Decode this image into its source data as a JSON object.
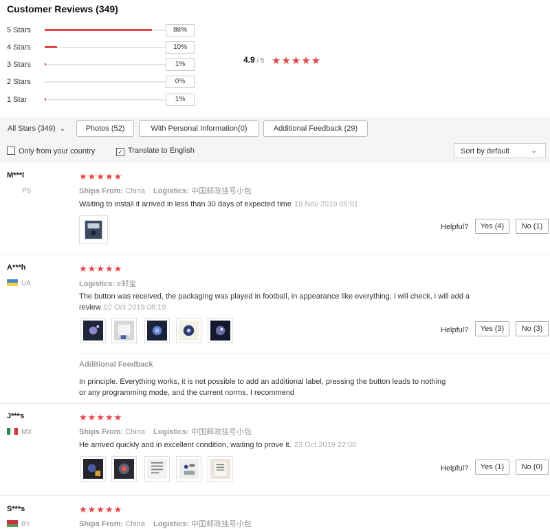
{
  "header": {
    "title": "Customer Reviews (349)"
  },
  "distribution": [
    {
      "label": "5 Stars",
      "pct_text": "88%",
      "fraction": 0.88
    },
    {
      "label": "4 Stars",
      "pct_text": "10%",
      "fraction": 0.1
    },
    {
      "label": "3 Stars",
      "pct_text": "1%",
      "fraction": 0.01
    },
    {
      "label": "2 Stars",
      "pct_text": "0%",
      "fraction": 0.0
    },
    {
      "label": "1 Star",
      "pct_text": "1%",
      "fraction": 0.01
    }
  ],
  "overall": {
    "score": "4.9",
    "outof": " / 5",
    "stars": "★★★★★"
  },
  "filters": {
    "all_stars": "All Stars (349)",
    "all_stars_chevron": "⌄",
    "photos": "Photos (52)",
    "personal_info": "With Personal Information(0)",
    "additional_feedback": "Additional Feedback (29)",
    "only_country": "Only from your country",
    "translate": "Translate to English",
    "translate_checked": "✓",
    "sort": "Sort by default",
    "sort_chevron": "⌄"
  },
  "reviews": [
    {
      "name": "M***l",
      "country": "PS",
      "stars": "★★★★★",
      "ships_label": "Ships From:",
      "ships_value": "China",
      "logistics_label": "Logistics:",
      "logistics_value": "中国邮政挂号小包",
      "text": "Waiting to install it arrived in less than 30 days of expected time",
      "date": "18 Nov 2019 05:01",
      "helpful": "Helpful?",
      "yes": "Yes (4)",
      "no": "No (1)"
    },
    {
      "name": "A***h",
      "country": "UA",
      "stars": "★★★★★",
      "logistics_label": "Logistics:",
      "logistics_value": "e邮宝",
      "text_line1": "The button was received, the packaging was played in football, in appearance like everything, i will check, i will add a",
      "text_line2": "review",
      "date": "02 Oct 2019 08:19",
      "helpful": "Helpful?",
      "yes": "Yes (3)",
      "no": "No (3)",
      "additional_title": "Additional Feedback",
      "additional_line1": "In principle. Everything works, it is not possible to add an additional label, pressing the button leads to nothing",
      "additional_line2": "or any programming mode, and the current norms, I recommend"
    },
    {
      "name": "J***s",
      "country": "MX",
      "stars": "★★★★★",
      "ships_label": "Ships From:",
      "ships_value": "China",
      "logistics_label": "Logistics:",
      "logistics_value": "中国邮政挂号小包",
      "text": "He arrived quickly and in excellent condition, waiting to prove it.",
      "date": "23 Oct 2019 22:00",
      "helpful": "Helpful?",
      "yes": "Yes (1)",
      "no": "No (0)"
    },
    {
      "name": "S***s",
      "country": "BY",
      "stars": "★★★★★",
      "ships_label": "Ships From:",
      "ships_value": "China",
      "logistics_label": "Logistics:",
      "logistics_value": "中国邮政挂号小包"
    }
  ],
  "colors": {
    "accent": "#e64545",
    "muted": "#999999",
    "border": "#cccccc"
  }
}
